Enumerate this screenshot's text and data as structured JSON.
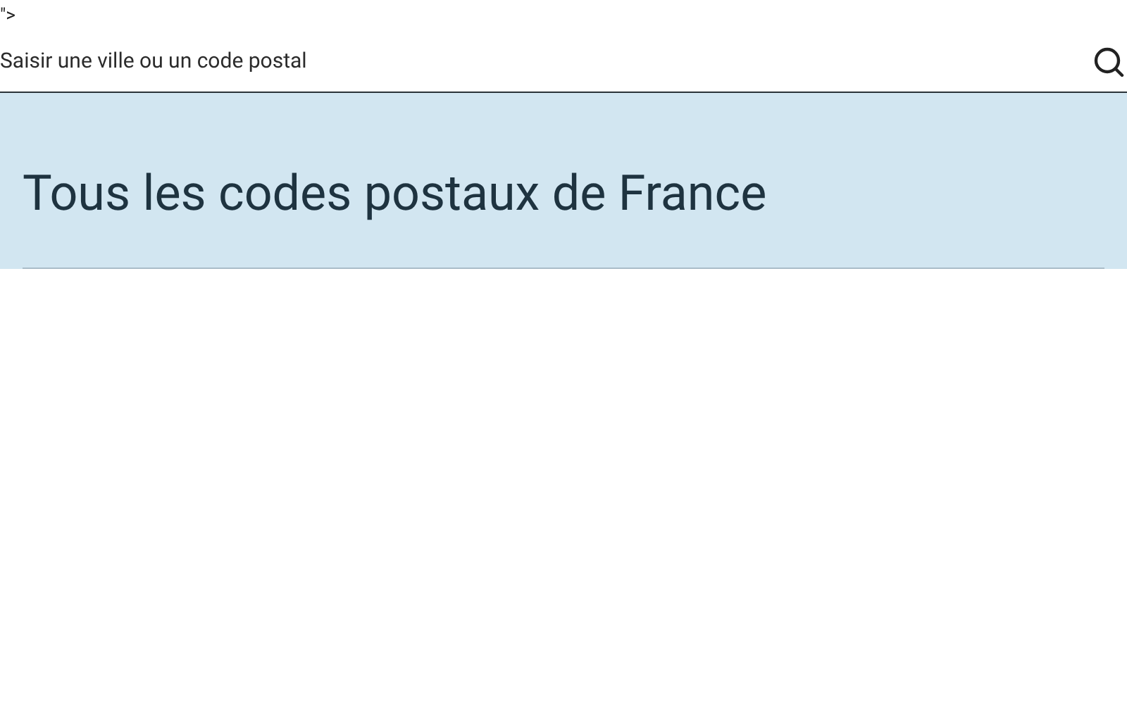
{
  "stray_text": "\">",
  "search": {
    "placeholder": "Saisir une ville ou un code postal"
  },
  "heading": "Tous les codes postaux de France"
}
